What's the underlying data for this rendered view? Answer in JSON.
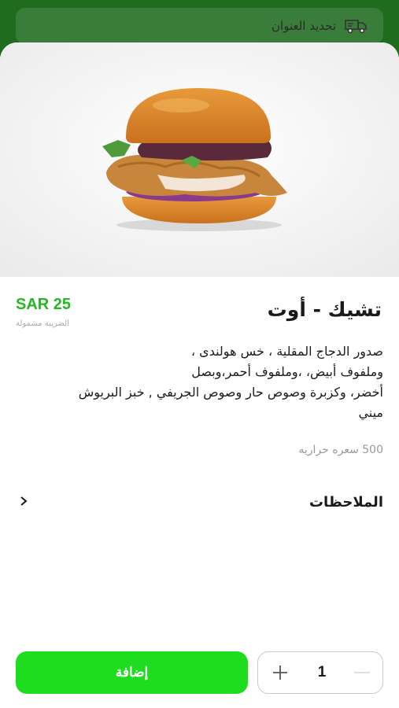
{
  "header": {
    "address_label": "تحديد العنوان",
    "icon": "delivery-truck-icon"
  },
  "product": {
    "title": "تشيك - أوت",
    "price": "SAR 25",
    "tax_note": "الضريبة مشمولة",
    "description_lines": [
      "صدور الدجاج المقلية ، خس هولندى ،",
      "وملفوف أبيض، ،وملفوف أحمر،وبصل",
      "أخضر، وكزبرة وصوص حار وصوص الجريفي , خبز البريوش",
      "ميني"
    ],
    "calories": "500 سعره حراريه",
    "image_icon": "burger-photo"
  },
  "notes": {
    "label": "الملاحظات",
    "icon": "chevron-right-icon"
  },
  "footer": {
    "add_label": "إضافة",
    "quantity": "1",
    "minus_icon": "minus-icon",
    "plus_icon": "plus-icon"
  },
  "colors": {
    "brand_green": "#1edc1e",
    "header_green": "#1f6c1f",
    "price_green": "#22b822"
  }
}
